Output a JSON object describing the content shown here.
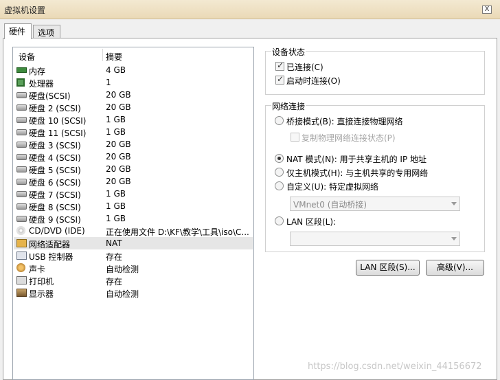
{
  "window": {
    "title": "虚拟机设置",
    "close_label": "X"
  },
  "tabs": [
    {
      "label": "硬件"
    },
    {
      "label": "选项"
    }
  ],
  "device_list": {
    "col_device": "设备",
    "col_summary": "摘要",
    "rows": [
      {
        "name": "内存",
        "summary": "4 GB",
        "icon": "memory-icon"
      },
      {
        "name": "处理器",
        "summary": "1",
        "icon": "processor-icon"
      },
      {
        "name": "硬盘(SCSI)",
        "summary": "20 GB",
        "icon": "hard-disk-icon"
      },
      {
        "name": "硬盘 2 (SCSI)",
        "summary": "20 GB",
        "icon": "hard-disk-icon"
      },
      {
        "name": "硬盘 10 (SCSI)",
        "summary": "1 GB",
        "icon": "hard-disk-icon"
      },
      {
        "name": "硬盘 11 (SCSI)",
        "summary": "1 GB",
        "icon": "hard-disk-icon"
      },
      {
        "name": "硬盘 3 (SCSI)",
        "summary": "20 GB",
        "icon": "hard-disk-icon"
      },
      {
        "name": "硬盘 4 (SCSI)",
        "summary": "20 GB",
        "icon": "hard-disk-icon"
      },
      {
        "name": "硬盘 5 (SCSI)",
        "summary": "20 GB",
        "icon": "hard-disk-icon"
      },
      {
        "name": "硬盘 6 (SCSI)",
        "summary": "20 GB",
        "icon": "hard-disk-icon"
      },
      {
        "name": "硬盘 7 (SCSI)",
        "summary": "1 GB",
        "icon": "hard-disk-icon"
      },
      {
        "name": "硬盘 8 (SCSI)",
        "summary": "1 GB",
        "icon": "hard-disk-icon"
      },
      {
        "name": "硬盘 9 (SCSI)",
        "summary": "1 GB",
        "icon": "hard-disk-icon"
      },
      {
        "name": "CD/DVD (IDE)",
        "summary": "正在使用文件 D:\\KF\\教学\\工具\\iso\\C...",
        "icon": "cd-dvd-icon"
      },
      {
        "name": "网络适配器",
        "summary": "NAT",
        "icon": "network-adapter-icon",
        "selected": true
      },
      {
        "name": "USB 控制器",
        "summary": "存在",
        "icon": "usb-icon"
      },
      {
        "name": "声卡",
        "summary": "自动检测",
        "icon": "sound-card-icon"
      },
      {
        "name": "打印机",
        "summary": "存在",
        "icon": "printer-icon"
      },
      {
        "name": "显示器",
        "summary": "自动检测",
        "icon": "monitor-icon"
      }
    ]
  },
  "device_status": {
    "title": "设备状态",
    "connected": {
      "label": "已连接(C)",
      "checked": true
    },
    "connect_at_power_on": {
      "label": "启动时连接(O)",
      "checked": true
    }
  },
  "network": {
    "title": "网络连接",
    "bridged": {
      "label": "桥接模式(B): 直接连接物理网络",
      "selected": false
    },
    "replicate": {
      "label": "复制物理网络连接状态(P)",
      "checked": false,
      "enabled": false
    },
    "nat": {
      "label": "NAT 模式(N): 用于共享主机的 IP 地址",
      "selected": true
    },
    "host_only": {
      "label": "仅主机模式(H): 与主机共享的专用网络",
      "selected": false
    },
    "custom": {
      "label": "自定义(U): 特定虚拟网络",
      "selected": false
    },
    "custom_select": {
      "value": "VMnet0 (自动桥接)",
      "enabled": false
    },
    "lan_segment": {
      "label": "LAN 区段(L):",
      "selected": false
    },
    "lan_select": {
      "value": "",
      "enabled": false
    }
  },
  "buttons": {
    "lan_segments": "LAN 区段(S)...",
    "advanced": "高级(V)..."
  },
  "watermark": "https://blog.csdn.net/weixin_44156672",
  "colors": {
    "titlebar": "#ead9b6",
    "selected_row": "#e6e6e6"
  }
}
